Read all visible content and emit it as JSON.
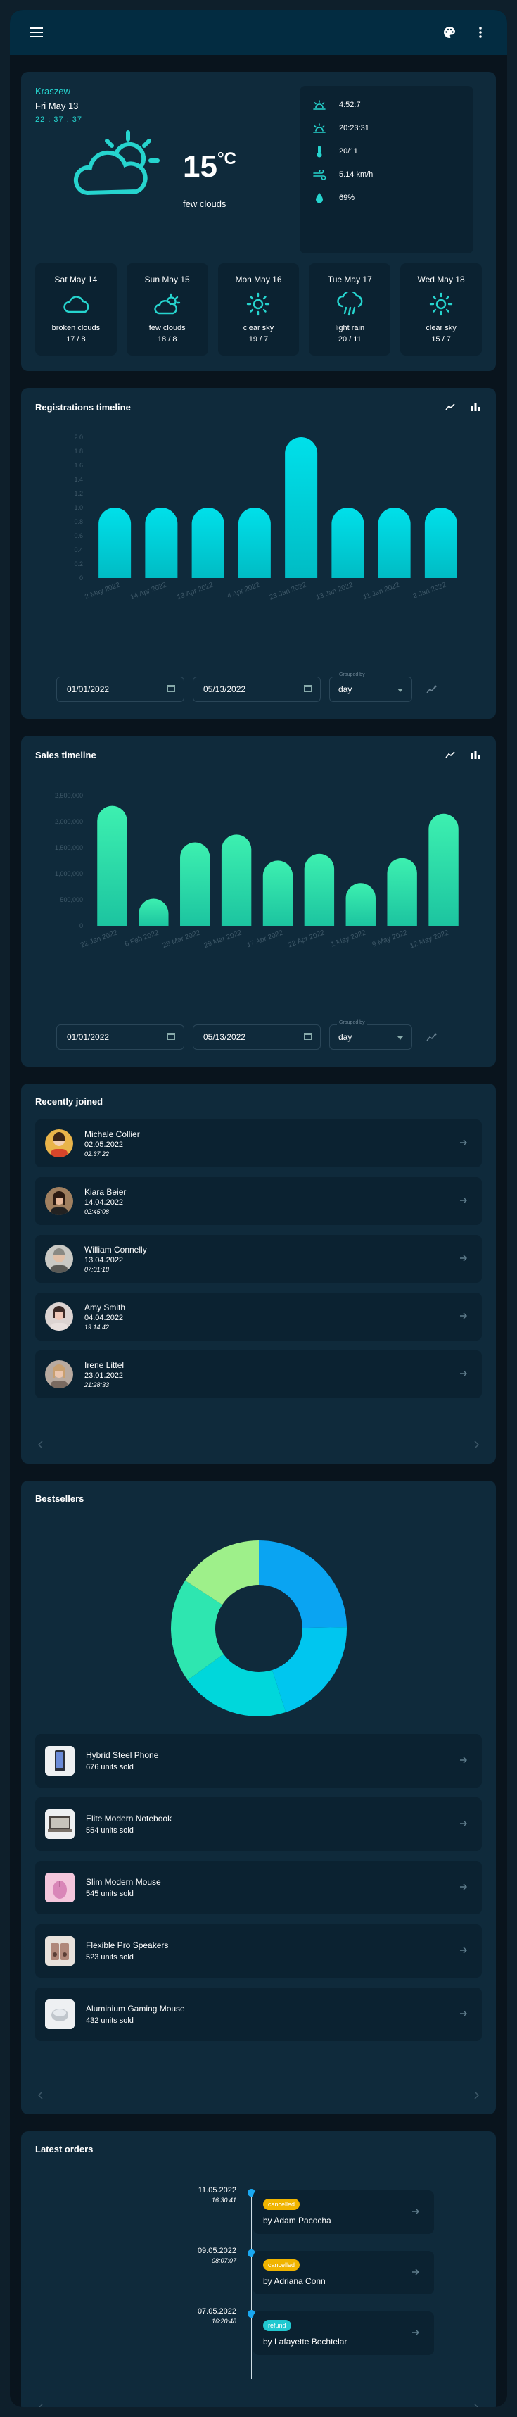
{
  "appbar": {
    "menu_icon": "menu-icon",
    "palette_icon": "palette-icon",
    "more_icon": "more-vert-icon"
  },
  "weather": {
    "city": "Kraszew",
    "date": "Fri May 13",
    "time": "22 : 37 : 37",
    "temperature": "15",
    "unit": "°C",
    "condition": "few clouds",
    "stats": {
      "sunrise": "4:52:7",
      "sunset": "20:23:31",
      "temp_range": "20/11",
      "wind": "5.14 km/h",
      "humidity": "69%"
    },
    "forecast": [
      {
        "day": "Sat May 14",
        "condition": "broken clouds",
        "temps": "17 / 8",
        "icon": "broken-clouds-icon"
      },
      {
        "day": "Sun May 15",
        "condition": "few clouds",
        "temps": "18 / 8",
        "icon": "few-clouds-icon"
      },
      {
        "day": "Mon May 16",
        "condition": "clear sky",
        "temps": "19 / 7",
        "icon": "clear-sky-icon"
      },
      {
        "day": "Tue May 17",
        "condition": "light rain",
        "temps": "20 / 11",
        "icon": "light-rain-icon"
      },
      {
        "day": "Wed May 18",
        "condition": "clear sky",
        "temps": "15 / 7",
        "icon": "clear-sky-icon"
      }
    ]
  },
  "registrations": {
    "title": "Registrations timeline",
    "from": "01/01/2022",
    "to": "05/13/2022",
    "group_label": "Grouped by",
    "group": "day"
  },
  "sales": {
    "title": "Sales timeline",
    "from": "01/01/2022",
    "to": "05/13/2022",
    "group_label": "Grouped by",
    "group": "day"
  },
  "chart_data": [
    {
      "type": "bar",
      "categories": [
        "2 May 2022",
        "14 Apr 2022",
        "13 Apr 2022",
        "4 Apr 2022",
        "23 Jan 2022",
        "13 Jan 2022",
        "11 Jan 2022",
        "2 Jan 2022"
      ],
      "values": [
        1,
        1,
        1,
        1,
        2,
        1,
        1,
        1
      ],
      "ylim": [
        0,
        2
      ],
      "yticks": [
        "0",
        "0.2",
        "0.4",
        "0.6",
        "0.8",
        "1.0",
        "1.2",
        "1.4",
        "1.6",
        "1.8",
        "2.0"
      ],
      "grid": false,
      "colors": [
        "#00e0ea",
        "#00bcc4"
      ]
    },
    {
      "type": "bar",
      "categories": [
        "22 Jan 2022",
        "6 Feb 2022",
        "28 Mar 2022",
        "29 Mar 2022",
        "17 Apr 2022",
        "22 Apr 2022",
        "1 May 2022",
        "9 May 2022",
        "12 May 2022"
      ],
      "values": [
        2300000,
        520000,
        1600000,
        1750000,
        1250000,
        1380000,
        820000,
        1300000,
        2150000
      ],
      "ylim": [
        0,
        2700000
      ],
      "yticks": [
        "0",
        "500,000",
        "1,000,000",
        "1,500,000",
        "2,000,000",
        "2,500,000"
      ],
      "grid": false,
      "colors": [
        "#3df0b0",
        "#1cc4a0"
      ]
    },
    {
      "type": "pie",
      "donut": true,
      "labels": [
        "Hybrid Steel Phone",
        "Elite Modern Notebook",
        "Slim Modern Mouse",
        "Flexible Pro Speakers",
        "Aluminium Gaming Mouse"
      ],
      "values": [
        676,
        554,
        545,
        523,
        432
      ],
      "colors": [
        "#0aa4f2",
        "#00c6ef",
        "#00d7db",
        "#2ee6b0",
        "#9ef08a"
      ]
    }
  ],
  "recently_joined": {
    "title": "Recently joined",
    "users": [
      {
        "name": "Michale Collier",
        "date": "02.05.2022",
        "time": "02:37:22"
      },
      {
        "name": "Kiara Beier",
        "date": "14.04.2022",
        "time": "02:45:08"
      },
      {
        "name": "William Connelly",
        "date": "13.04.2022",
        "time": "07:01:18"
      },
      {
        "name": "Amy Smith",
        "date": "04.04.2022",
        "time": "19:14:42"
      },
      {
        "name": "Irene Littel",
        "date": "23.01.2022",
        "time": "21:28:33"
      }
    ]
  },
  "bestsellers": {
    "title": "Bestsellers",
    "products": [
      {
        "name": "Hybrid Steel Phone",
        "sold": "676 units sold"
      },
      {
        "name": "Elite Modern Notebook",
        "sold": "554 units sold"
      },
      {
        "name": "Slim Modern Mouse",
        "sold": "545 units sold"
      },
      {
        "name": "Flexible Pro Speakers",
        "sold": "523 units sold"
      },
      {
        "name": "Aluminium Gaming Mouse",
        "sold": "432 units sold"
      }
    ]
  },
  "orders": {
    "title": "Latest orders",
    "items": [
      {
        "date": "11.05.2022",
        "time": "16:30:41",
        "status": "cancelled",
        "by": "by Adam Pacocha",
        "color": "#f0b400"
      },
      {
        "date": "09.05.2022",
        "time": "08:07:07",
        "status": "cancelled",
        "by": "by Adriana Conn",
        "color": "#f0b400"
      },
      {
        "date": "07.05.2022",
        "time": "16:20:48",
        "status": "refund",
        "by": "by Lafayette Bechtelar",
        "color": "#20c8d0"
      }
    ]
  }
}
